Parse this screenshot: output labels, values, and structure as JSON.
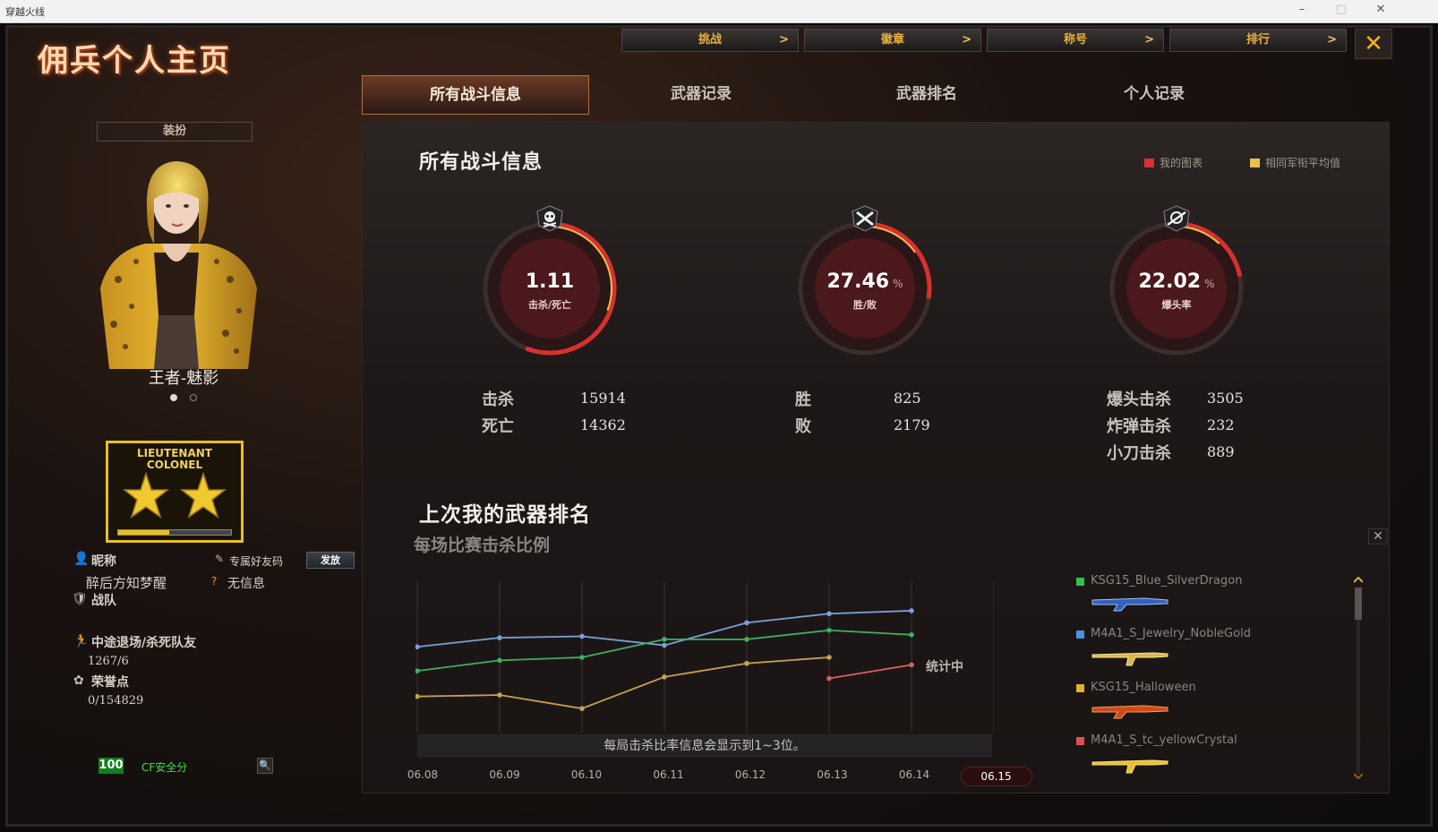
{
  "window": {
    "title": "穿越火线"
  },
  "header": {
    "page_title": "佣兵个人主页",
    "top_buttons": [
      {
        "label": "挑战"
      },
      {
        "label": "徽章"
      },
      {
        "label": "称号"
      },
      {
        "label": "排行"
      }
    ],
    "arrow": ">",
    "close": "✕"
  },
  "tabs": [
    {
      "label": "所有战斗信息",
      "active": true
    },
    {
      "label": "武器记录",
      "active": false
    },
    {
      "label": "武器排名",
      "active": false
    },
    {
      "label": "个人记录",
      "active": false
    }
  ],
  "profile": {
    "outfit_label": "装扮",
    "character_name": "王者-魅影",
    "rank_text_1": "LIEUTENANT",
    "rank_text_2": "COLONEL",
    "rank_progress": 0.45,
    "nickname_label": "昵称",
    "nickname": "醉后方知梦醒",
    "friend_code_label": "专属好友码",
    "send_button": "发放",
    "no_info": "无信息",
    "team_label": "战队",
    "quit_label": "中途退场/杀死队友",
    "quit_value": "1267/6",
    "honor_label": "荣誉点",
    "honor_value": "0/154829",
    "cf_score": "100",
    "cf_label": "CF安全分"
  },
  "stats": {
    "section_title": "所有战斗信息",
    "legend_mine": "我的图表",
    "legend_avg": "相同军衔平均值",
    "colors": {
      "mine": "#d83030",
      "avg": "#e8c050"
    },
    "gauges": [
      {
        "value": "1.11",
        "unit": "",
        "label": "击杀/死亡",
        "fill": 0.56,
        "icon": "skull-icon"
      },
      {
        "value": "27.46",
        "unit": "%",
        "label": "胜/败",
        "fill": 0.2746,
        "icon": "crossed-guns-icon"
      },
      {
        "value": "22.02",
        "unit": "%",
        "label": "爆头率",
        "fill": 0.2202,
        "icon": "headshot-icon"
      }
    ],
    "kill_label": "击杀",
    "kill_value": "15914",
    "death_label": "死亡",
    "death_value": "14362",
    "win_label": "胜",
    "win_value": "825",
    "lose_label": "败",
    "lose_value": "2179",
    "headshot_label": "爆头击杀",
    "headshot_value": "3505",
    "bomb_label": "炸弹击杀",
    "bomb_value": "232",
    "knife_label": "小刀击杀",
    "knife_value": "889"
  },
  "weapon_rank": {
    "title": "上次我的武器排名",
    "subtitle": "每场比赛击杀比例",
    "counting": "统计中",
    "note": "每局击杀比率信息会显示到1~3位。",
    "weapons": [
      {
        "name": "KSG15_Blue_SilverDragon",
        "color": "#30c050"
      },
      {
        "name": "M4A1_S_Jewelry_NobleGold",
        "color": "#4a90e0"
      },
      {
        "name": "KSG15_Halloween",
        "color": "#e0b030"
      },
      {
        "name": "M4A1_S_tc_yellowCrystal",
        "color": "#e05050"
      }
    ]
  },
  "chart_data": {
    "type": "line",
    "title": "每场比赛击杀比例",
    "x": [
      "06.08",
      "06.09",
      "06.10",
      "06.11",
      "06.12",
      "06.13",
      "06.14",
      "06.15"
    ],
    "selected_x": "06.15",
    "ylim": [
      0,
      100
    ],
    "series": [
      {
        "color": "#7aa0d8",
        "values": [
          57,
          63,
          64,
          58,
          73,
          79,
          81,
          null
        ]
      },
      {
        "color": "#40b060",
        "values": [
          41,
          48,
          50,
          62,
          62,
          68,
          65,
          null
        ]
      },
      {
        "color": "#c8a050",
        "values": [
          24,
          25,
          16,
          37,
          46,
          50,
          null,
          null
        ]
      },
      {
        "color": "#d86060",
        "values": [
          null,
          null,
          null,
          null,
          null,
          36,
          45,
          null
        ]
      }
    ]
  }
}
